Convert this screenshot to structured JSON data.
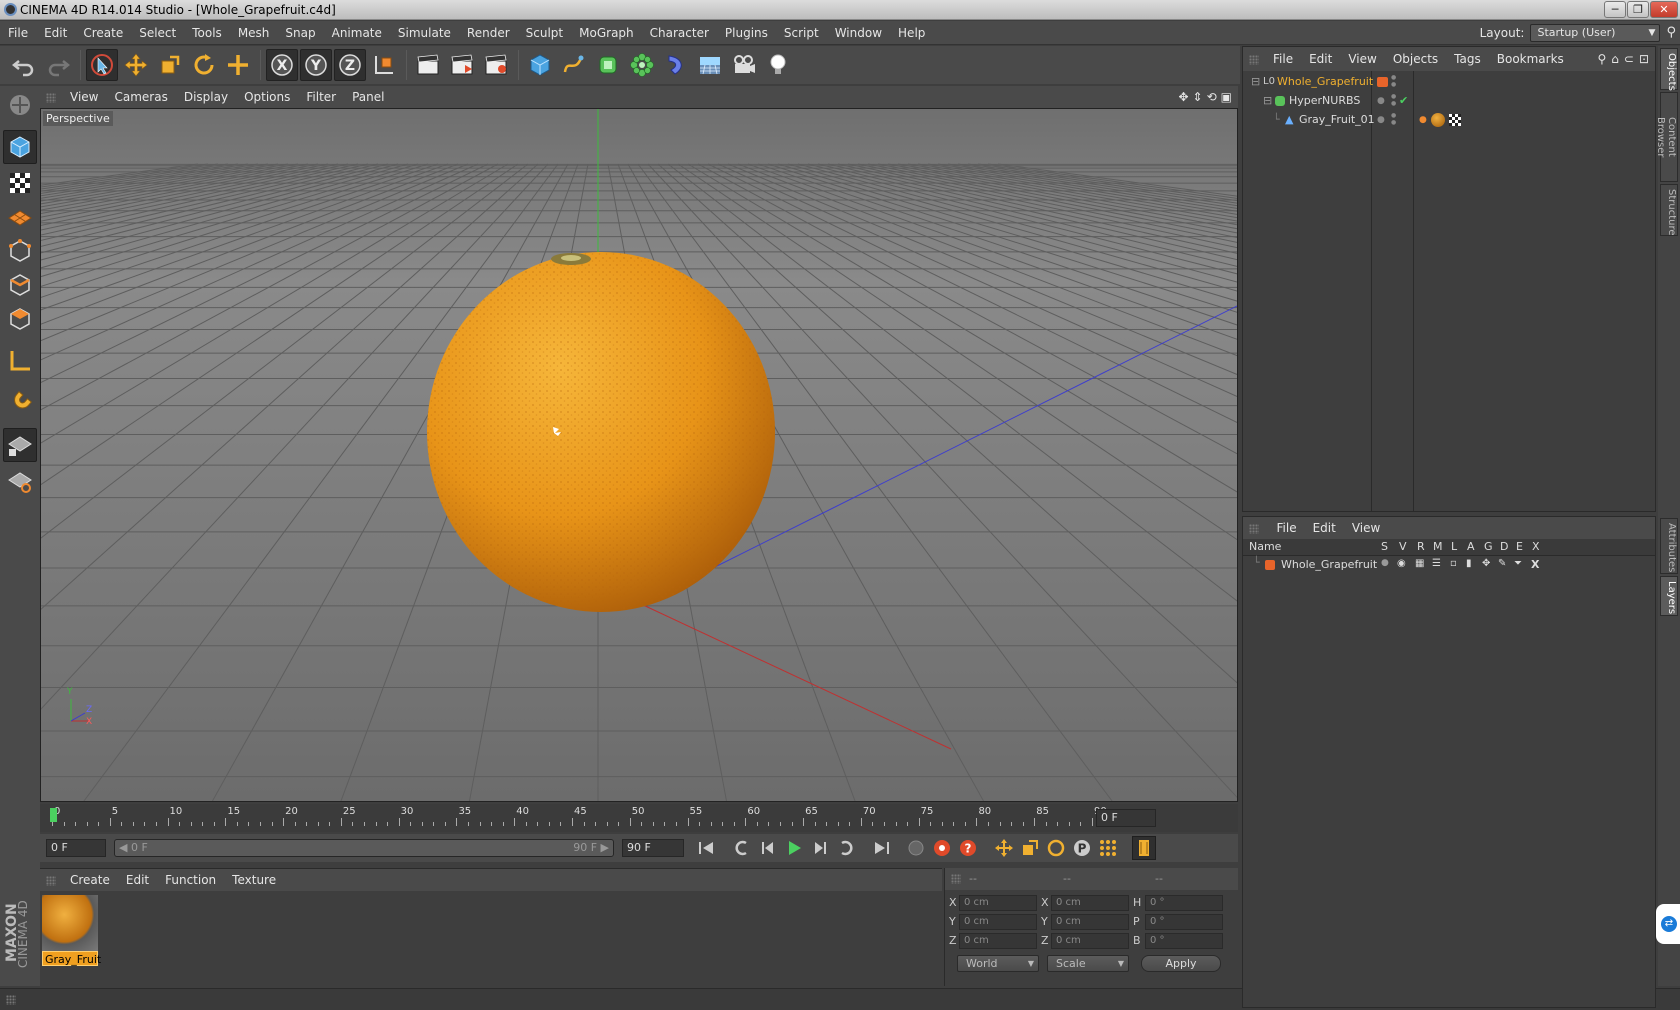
{
  "window": {
    "title": "CINEMA 4D R14.014 Studio - [Whole_Grapefruit.c4d]",
    "minimize": "─",
    "restore": "❐",
    "close": "✕"
  },
  "menubar": {
    "items": [
      "File",
      "Edit",
      "Create",
      "Select",
      "Tools",
      "Mesh",
      "Snap",
      "Animate",
      "Simulate",
      "Render",
      "Sculpt",
      "MoGraph",
      "Character",
      "Plugins",
      "Script",
      "Window",
      "Help"
    ],
    "layout_label": "Layout:",
    "layout_value": "Startup (User)"
  },
  "viewport": {
    "menu": [
      "View",
      "Cameras",
      "Display",
      "Options",
      "Filter",
      "Panel"
    ],
    "label": "Perspective",
    "axis_labels": {
      "y": "Y",
      "z": "Z",
      "x": "X"
    }
  },
  "timeline": {
    "ticks": [
      "0",
      "5",
      "10",
      "15",
      "20",
      "25",
      "30",
      "35",
      "40",
      "45",
      "50",
      "55",
      "60",
      "65",
      "70",
      "75",
      "80",
      "85",
      "90"
    ],
    "current_frame": "0 F"
  },
  "transport": {
    "start_field": "0 F",
    "range_start": "◀ 0 F",
    "range_end": "90 F ▶",
    "end_field": "90 F"
  },
  "material_manager": {
    "menu": [
      "Create",
      "Edit",
      "Function",
      "Texture"
    ],
    "material_name": "Gray_Fruit"
  },
  "coordinates": {
    "headers": [
      "--",
      "--",
      "--"
    ],
    "rows": [
      {
        "axis": "X",
        "pos": "0 cm",
        "axis2": "X",
        "size": "0 cm",
        "rlabel": "H",
        "rot": "0 °"
      },
      {
        "axis": "Y",
        "pos": "0 cm",
        "axis2": "Y",
        "size": "0 cm",
        "rlabel": "P",
        "rot": "0 °"
      },
      {
        "axis": "Z",
        "pos": "0 cm",
        "axis2": "Z",
        "size": "0 cm",
        "rlabel": "B",
        "rot": "0 °"
      }
    ],
    "world_select": "World",
    "scale_select": "Scale",
    "apply": "Apply"
  },
  "object_manager": {
    "menu": [
      "File",
      "Edit",
      "View",
      "Objects",
      "Tags",
      "Bookmarks"
    ],
    "objects": [
      {
        "name": "Whole_Grapefruit",
        "color": "#e8642a"
      },
      {
        "name": "HyperNURBS",
        "color": "#59c25a"
      },
      {
        "name": "Gray_Fruit_01",
        "color": "#6ab0ff"
      }
    ]
  },
  "layer_manager": {
    "menu": [
      "File",
      "Edit",
      "View"
    ],
    "columns": [
      "Name",
      "S",
      "V",
      "R",
      "M",
      "L",
      "A",
      "G",
      "D",
      "E",
      "X"
    ],
    "layers": [
      {
        "name": "Whole_Grapefruit",
        "color": "#e8642a"
      }
    ]
  },
  "side_tabs": {
    "top": [
      "Objects",
      "Content Browser",
      "Structure"
    ],
    "bottom": [
      "Attributes",
      "Layers"
    ]
  },
  "brand": {
    "line1": "MAXON",
    "line2": "CINEMA 4D"
  },
  "colors": {
    "accent": "#e8a23a",
    "fruit": "#e99a1d",
    "fruit_dark": "#b8650b"
  }
}
